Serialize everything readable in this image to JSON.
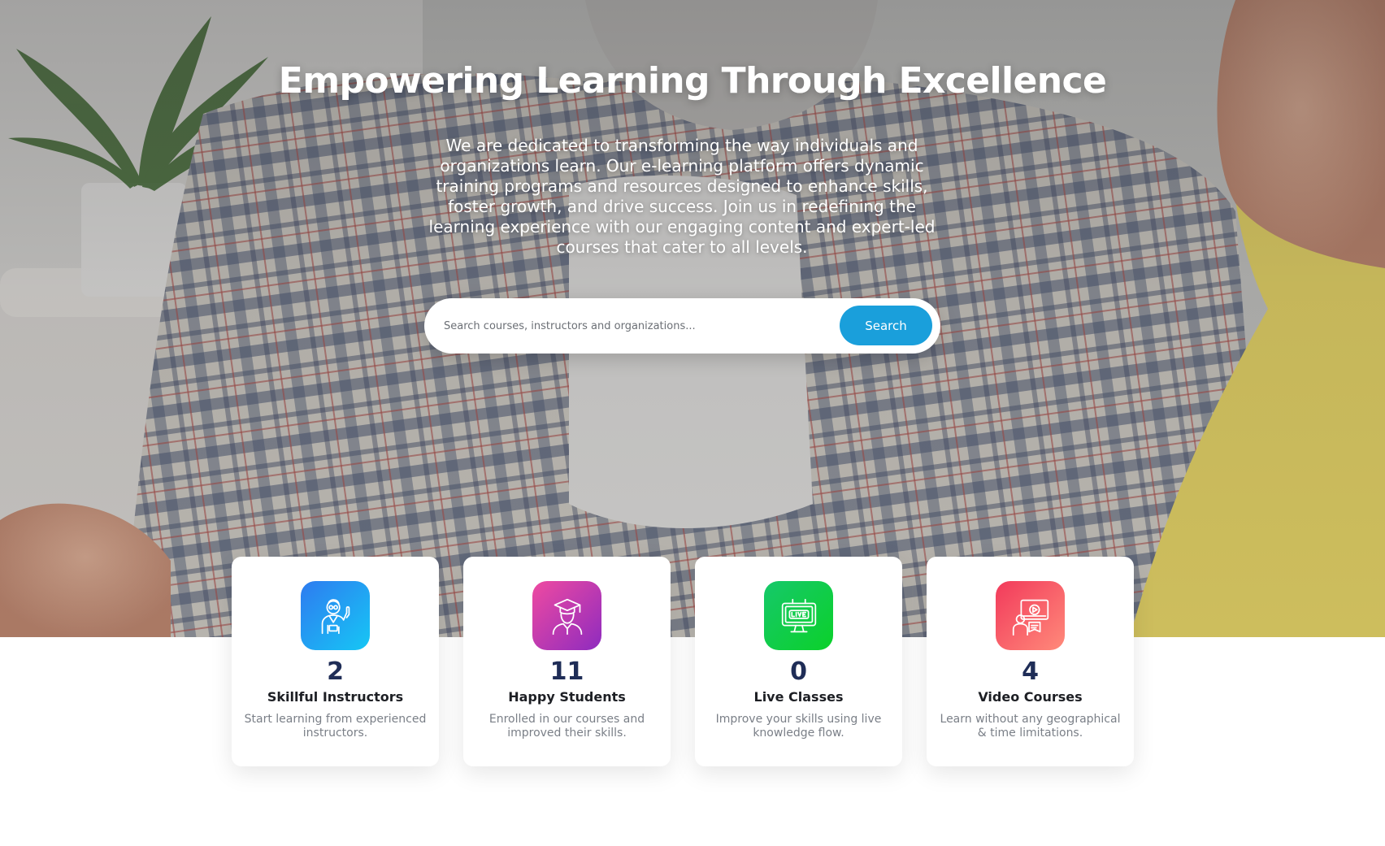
{
  "hero": {
    "title": "Empowering Learning Through Excellence",
    "description": "We are dedicated to transforming the way individuals and organizations learn. Our e-learning platform offers dynamic training programs and resources designed to enhance skills, foster growth, and drive success. Join us in redefining the learning experience with our engaging content and expert-led courses that cater to all levels."
  },
  "search": {
    "placeholder": "Search courses, instructors and organizations...",
    "value": "",
    "button_label": "Search"
  },
  "stats": [
    {
      "count": "2",
      "title": "Skillful Instructors",
      "description": "Start learning from experienced instructors.",
      "icon": "instructor-icon"
    },
    {
      "count": "11",
      "title": "Happy Students",
      "description": "Enrolled in our courses and improved their skills.",
      "icon": "graduate-student-icon"
    },
    {
      "count": "0",
      "title": "Live Classes",
      "description": "Improve your skills using live knowledge flow.",
      "icon": "live-monitor-icon"
    },
    {
      "count": "4",
      "title": "Video Courses",
      "description": "Learn without any geographical & time limitations.",
      "icon": "video-course-icon"
    }
  ],
  "colors": {
    "search_button": "#1a9fdb",
    "count_text": "#1f2d57",
    "icon_blue": "#2e7bf0",
    "icon_pink": "#ef4aa1",
    "icon_green": "#16c86a",
    "icon_red": "#f23a5b"
  }
}
